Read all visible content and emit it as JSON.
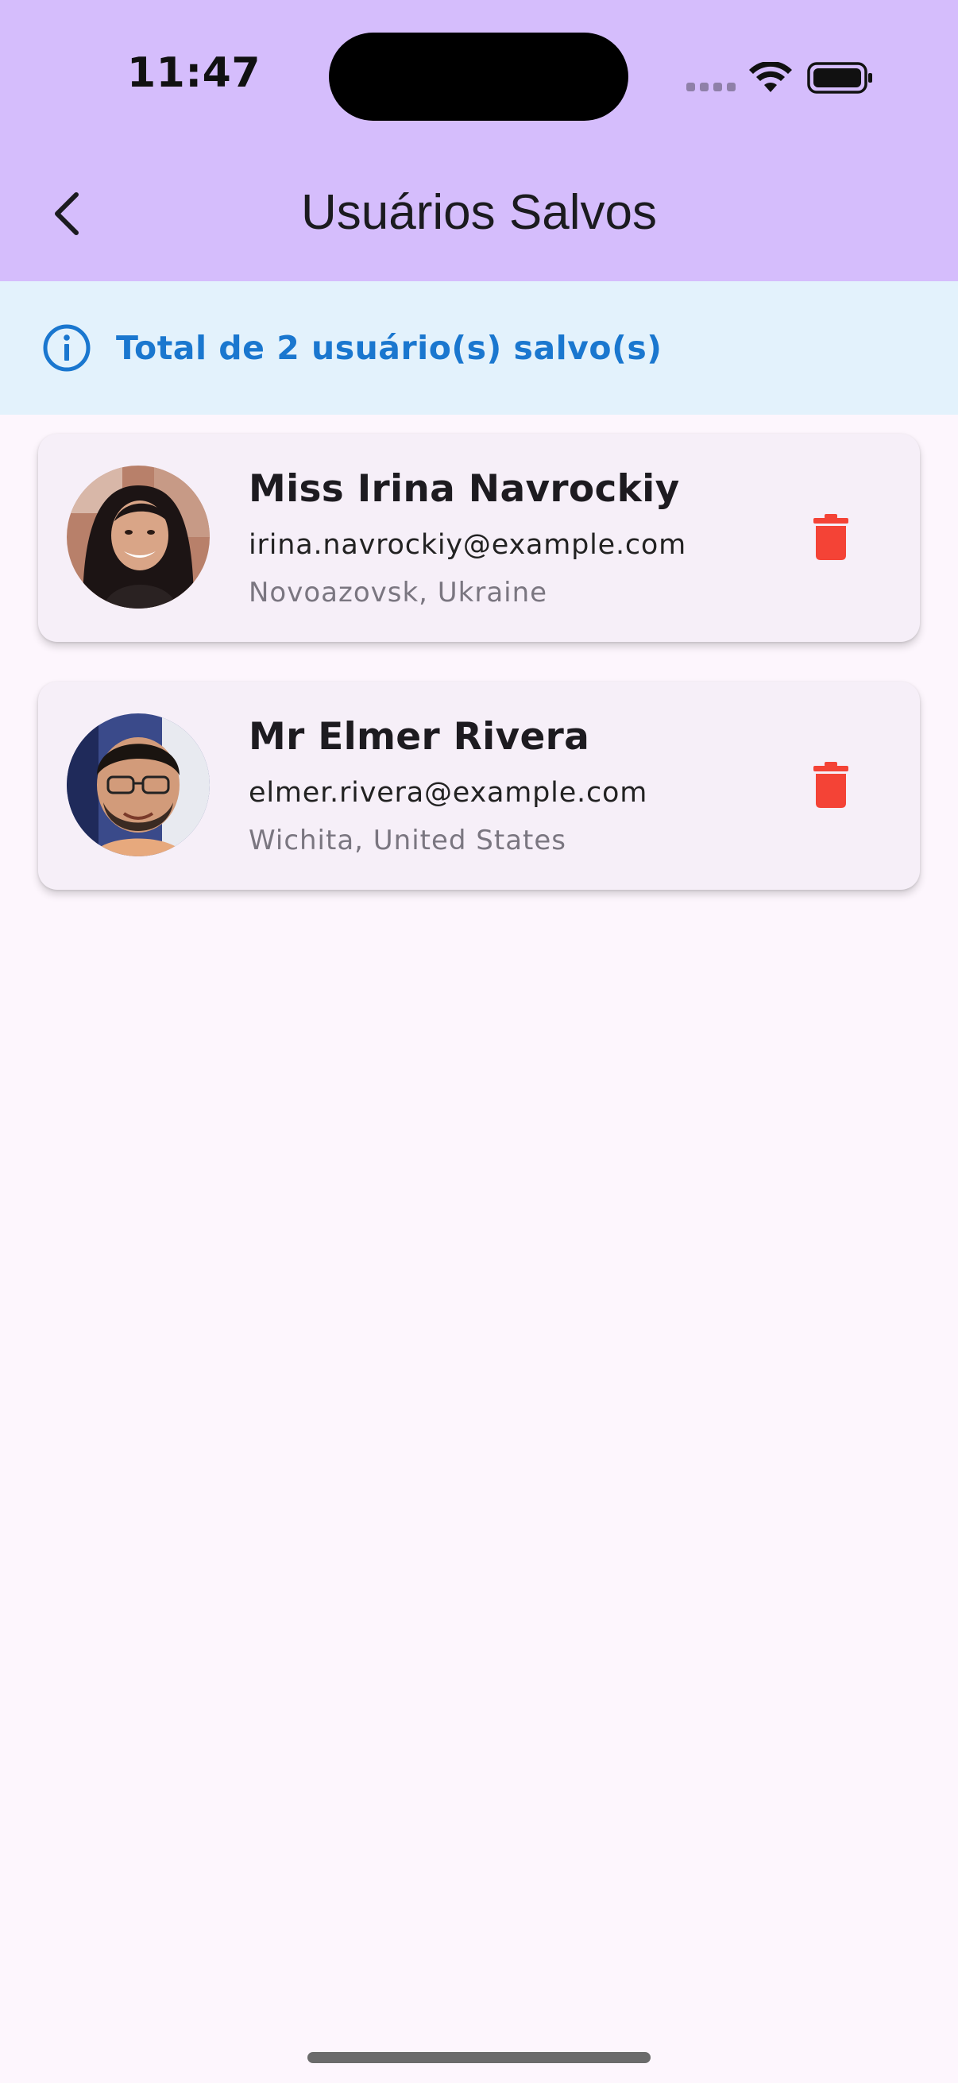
{
  "status_bar": {
    "time": "11:47"
  },
  "app_bar": {
    "title": "Usuários Salvos",
    "back_icon": "chevron-left-icon"
  },
  "info_banner": {
    "icon": "info-circle-icon",
    "text": "Total de 2 usuário(s) salvo(s)"
  },
  "users": [
    {
      "name": "Miss Irina Navrockiy",
      "email": "irina.navrockiy@example.com",
      "location": "Novoazovsk, Ukraine",
      "delete_icon": "trash-icon"
    },
    {
      "name": "Mr Elmer Rivera",
      "email": "elmer.rivera@example.com",
      "location": "Wichita, United States",
      "delete_icon": "trash-icon"
    }
  ],
  "colors": {
    "app_bar": "#d5bdfc",
    "background": "#fdf6fd",
    "info_banner": "#e3f2fc",
    "info_accent": "#1a77cf",
    "card": "#f6eff8",
    "delete": "#f44336"
  }
}
